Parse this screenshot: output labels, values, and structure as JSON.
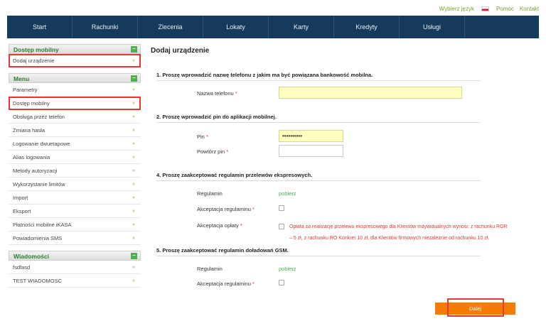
{
  "topbar": {
    "language_label": "Wybierz język",
    "help": "Pomoc",
    "contact": "Kontakt"
  },
  "nav": [
    "Start",
    "Rachunki",
    "Zlecenia",
    "Lokaty",
    "Karty",
    "Kredyty",
    "Usługi",
    ""
  ],
  "sidebar": {
    "mobile_head": "Dostęp mobilny",
    "mobile_items": [
      "Dodaj urządzenie"
    ],
    "menu_head": "Menu",
    "menu_items": [
      "Parametry",
      "Dostęp mobilny",
      "Obsługa przez telefon",
      "Zmiana hasła",
      "Logowanie dwuetapowe",
      "Alias logowania",
      "Metody autoryzacji",
      "Wykorzystanie limitów",
      "Import",
      "Eksport",
      "Płatności mobilne iKASA",
      "Powiadomienia SMS"
    ],
    "messages_head": "Wiadomości",
    "messages_items": [
      "fsdfasd",
      "TEST WIADOMOSC"
    ],
    "toggle": "−",
    "arrow": "»"
  },
  "main": {
    "title": "Dodaj urządzenie",
    "s1": "1. Proszę wprowadzić nazwę telefonu z jakim ma być powiązana bankowość mobilna.",
    "phone_label": "Nazwa telefonu",
    "s2": "2. Proszę wprowadzić pin do aplikacji mobilnej.",
    "pin_label": "Pin",
    "pin_value": "••••••••••",
    "pin_repeat_label": "Powtórz pin",
    "s4": "4. Proszę zaakceptować regulamin przelewów ekspresowych.",
    "regulamin_label": "Regulamin",
    "regulamin_link": "pobierz",
    "accept_regulamin": "Akceptacja regulaminu",
    "accept_fee": "Akceptacja opłaty",
    "fee_note_1": "Opłata za realizację przelewu ekspresowego dla Klientów indywidualnych wynosi: z rachunku ROR",
    "fee_note_2": "– 5 zł, z rachunku RO Konkret 10 zł, dla Klientów firmowych niezależnie od rachunku 10 zł.",
    "s5": "5. Proszę zaakceptować regulamin doładowań GSM.",
    "regulamin2_label": "Regulamin",
    "regulamin2_link": "pobierz",
    "accept_regulamin2": "Akceptacja regulaminu",
    "req": "*",
    "next": "Dalej"
  },
  "colors": {
    "nav_bg": "#163a5c",
    "accent_green": "#4caf50",
    "orange": "#f57c00",
    "highlight_red": "#e53935"
  }
}
